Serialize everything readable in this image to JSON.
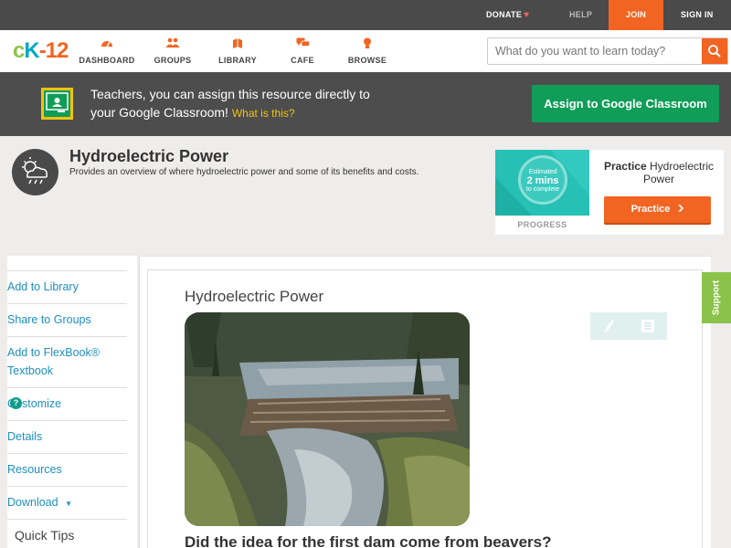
{
  "topbar": {
    "donate": "DONATE",
    "help": "HELP",
    "join": "JOIN",
    "signin": "SIGN IN"
  },
  "header": {
    "logo": {
      "part1": "c",
      "part2": "K",
      "part3": "-12"
    },
    "nav": [
      {
        "label": "DASHBOARD",
        "icon": "dashboard-icon"
      },
      {
        "label": "GROUPS",
        "icon": "groups-icon"
      },
      {
        "label": "LIBRARY",
        "icon": "library-icon"
      },
      {
        "label": "CAFE",
        "icon": "cafe-icon"
      },
      {
        "label": "BROWSE",
        "icon": "browse-icon"
      }
    ],
    "search": {
      "placeholder": "What do you want to learn today?",
      "value": ""
    }
  },
  "classroom_banner": {
    "line1": "Teachers, you can assign this resource directly to",
    "line2": "your Google Classroom!",
    "what_link": "What is this?",
    "assign_button": "Assign to Google Classroom"
  },
  "concept": {
    "title": "Hydroelectric Power",
    "description": "Provides an overview of where hydroelectric power and some of its benefits and costs."
  },
  "practice_card": {
    "estimated_line1": "Estimated",
    "estimated_minutes": "2 mins",
    "estimated_line3": "to complete",
    "progress_label": "PROGRESS",
    "title_bold": "Practice",
    "title_rest": "Hydroelectric Power",
    "button": "Practice"
  },
  "sidebar": {
    "items": [
      {
        "label": "Add to Library"
      },
      {
        "label": "Share to Groups"
      },
      {
        "label": "Add to FlexBook®",
        "label2": "Textbook"
      },
      {
        "label": "Customize"
      },
      {
        "label": "Details"
      },
      {
        "label": "Resources"
      },
      {
        "label": "Download"
      }
    ],
    "quick_tips": "Quick Tips"
  },
  "content": {
    "heading": "Hydroelectric Power",
    "question": "Did the idea for the first dam come from beavers?"
  },
  "support_tab": "Support",
  "colors": {
    "accent_orange": "#f26422",
    "google_green": "#0f9d58",
    "link_blue": "#1e8fbf",
    "support_green": "#8bc34a"
  }
}
